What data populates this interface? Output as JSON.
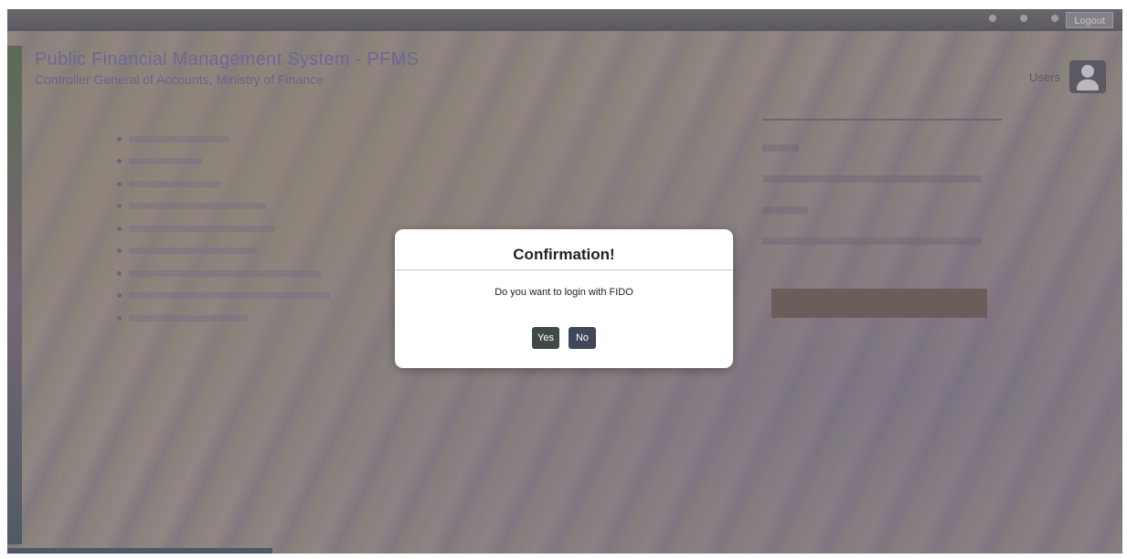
{
  "header": {
    "title": "Public Financial Management System - PFMS",
    "subtitle": "Controller General of Accounts, Ministry of Finance",
    "logout_label": "Logout",
    "user_label": "Users"
  },
  "icons": {
    "user_avatar": "user-avatar-icon"
  },
  "dialog": {
    "title": "Confirmation!",
    "message": "Do you want to login with FIDO",
    "yes_label": "Yes",
    "no_label": "No"
  },
  "colors": {
    "dialog_bg": "#ffffff",
    "yes_button": "#3f4a47",
    "no_button": "#3e4858"
  }
}
